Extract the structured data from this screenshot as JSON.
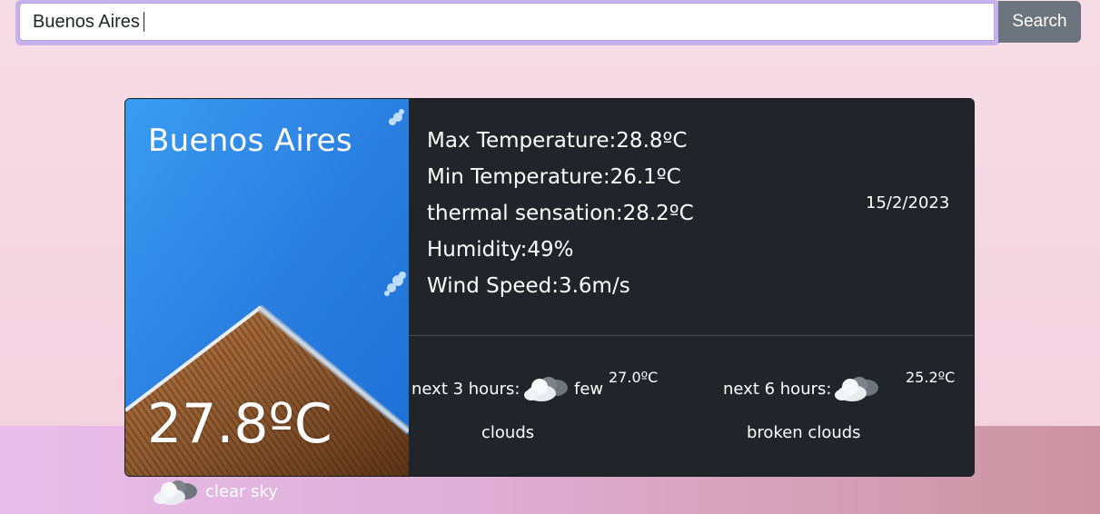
{
  "search": {
    "value": "Buenos Aires",
    "button_label": "Search"
  },
  "weather": {
    "city": "Buenos Aires",
    "current_temp": "27.8ºC",
    "current_description": "clear sky",
    "max_temp": "Max Temperature:28.8ºC",
    "min_temp": "Min Temperature:26.1ºC",
    "thermal_sensation": "thermal sensation:28.2ºC",
    "humidity": "Humidity:49%",
    "wind_speed": "Wind Speed:3.6m/s",
    "date": "15/2/2023"
  },
  "forecast": [
    {
      "label": "next 3 hours:",
      "temp": "27.0ºC",
      "desc_line1": "few",
      "desc_line2": "clouds",
      "icon": "cloud-icon"
    },
    {
      "label": "next 6 hours:",
      "temp": "25.2ºC",
      "desc_line1": "",
      "desc_line2": "broken clouds",
      "icon": "cloud-icon"
    }
  ],
  "colors": {
    "card_bg": "#212529",
    "search_button": "#6c757d",
    "focus_ring": "#c7b2ee"
  }
}
